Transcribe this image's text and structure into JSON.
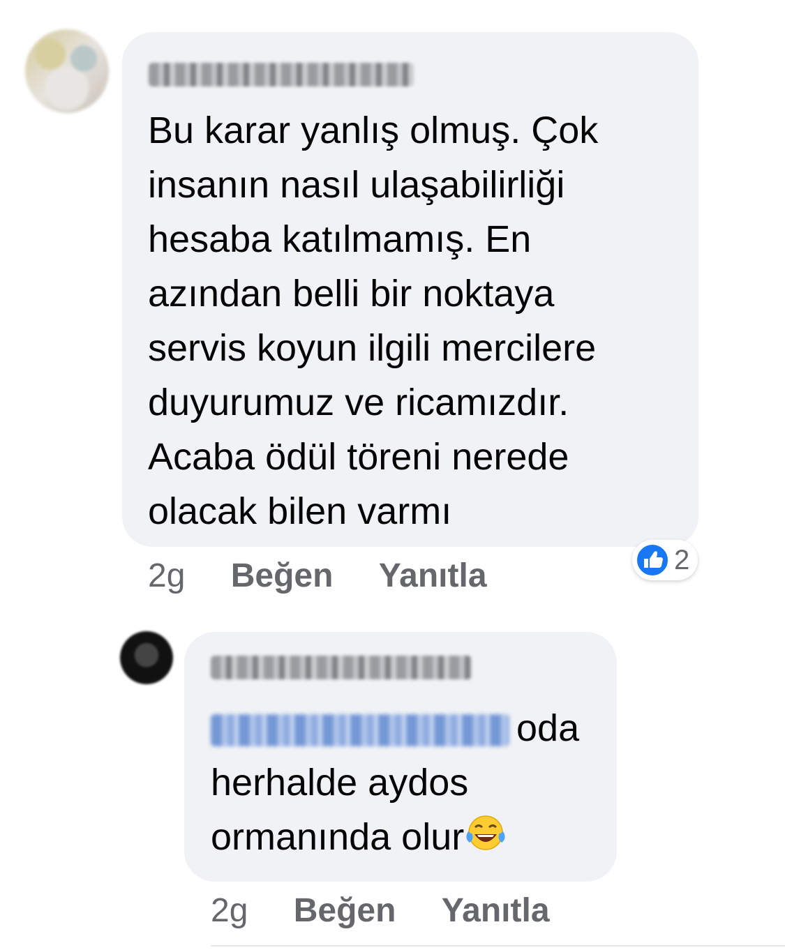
{
  "comments": [
    {
      "text": "Bu karar yanlış olmuş. Çok\ninsanın nasıl ulaşabilirliği\nhesaba katılmamış. En\nazından belli bir noktaya\nservis koyun ilgili mercilere\nduyurumuz ve ricamızdır.\nAcaba ödül töreni nerede\nolacak bilen varmı",
      "time": "2g",
      "like_label": "Beğen",
      "reply_label": "Yanıtla",
      "reaction": {
        "icon": "like-icon",
        "count": "2",
        "color": "#1877f2"
      }
    },
    {
      "text_after_mention": "oda\nherhalde aydos\normanında olur",
      "emoji": "face-with-tears-of-joy-icon",
      "time": "2g",
      "like_label": "Beğen",
      "reply_label": "Yanıtla"
    }
  ],
  "colors": {
    "bubble": "#f0f2f5",
    "meta_text": "#65676b",
    "text": "#050505",
    "accent": "#1877f2"
  }
}
